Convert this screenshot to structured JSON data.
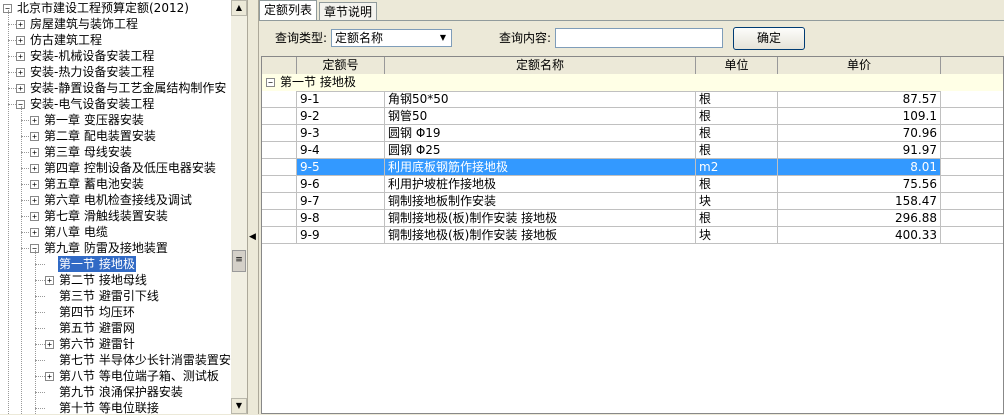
{
  "tree": {
    "root": "北京市建设工程预算定额(2012)",
    "top_items": [
      {
        "label": "房屋建筑与装饰工程",
        "expand": "+"
      },
      {
        "label": "仿古建筑工程",
        "expand": "+"
      },
      {
        "label": "安装-机械设备安装工程",
        "expand": "+"
      },
      {
        "label": "安装-热力设备安装工程",
        "expand": "+"
      },
      {
        "label": "安装-静置设备与工艺金属结构制作安",
        "expand": "+"
      },
      {
        "label": "安装-电气设备安装工程",
        "expand": "−"
      }
    ],
    "chapters": [
      {
        "label": "第一章 变压器安装",
        "expand": "+"
      },
      {
        "label": "第二章 配电装置安装",
        "expand": "+"
      },
      {
        "label": "第三章 母线安装",
        "expand": "+"
      },
      {
        "label": "第四章 控制设备及低压电器安装",
        "expand": "+"
      },
      {
        "label": "第五章 蓄电池安装",
        "expand": "+"
      },
      {
        "label": "第六章 电机检查接线及调试",
        "expand": "+"
      },
      {
        "label": "第七章 滑触线装置安装",
        "expand": "+"
      },
      {
        "label": "第八章 电缆",
        "expand": "+"
      },
      {
        "label": "第九章 防雷及接地装置",
        "expand": "−"
      }
    ],
    "sections": [
      {
        "label": "第一节 接地极",
        "expand": "",
        "selected": true
      },
      {
        "label": "第二节 接地母线",
        "expand": "+"
      },
      {
        "label": "第三节 避雷引下线",
        "expand": ""
      },
      {
        "label": "第四节 均压环",
        "expand": ""
      },
      {
        "label": "第五节 避雷网",
        "expand": ""
      },
      {
        "label": "第六节 避雷针",
        "expand": "+"
      },
      {
        "label": "第七节 半导体少长针消雷装置安",
        "expand": ""
      },
      {
        "label": "第八节 等电位端子箱、测试板",
        "expand": "+"
      },
      {
        "label": "第九节 浪涌保护器安装",
        "expand": ""
      },
      {
        "label": "第十节 等电位联接",
        "expand": ""
      }
    ]
  },
  "tabs": [
    "定额列表",
    "章节说明"
  ],
  "query": {
    "type_label": "查询类型:",
    "type_value": "定额名称",
    "content_label": "查询内容:",
    "content_value": "",
    "ok_label": "确定"
  },
  "grid": {
    "headers": [
      "定额号",
      "定额名称",
      "单位",
      "单价"
    ],
    "group": {
      "expand": "−",
      "label": "第一节 接地极"
    },
    "rows": [
      {
        "code": "9-1",
        "name": "角钢50*50",
        "unit": "根",
        "price": "87.57"
      },
      {
        "code": "9-2",
        "name": "钢管50",
        "unit": "根",
        "price": "109.1"
      },
      {
        "code": "9-3",
        "name": "圆钢 Φ19",
        "unit": "根",
        "price": "70.96"
      },
      {
        "code": "9-4",
        "name": "圆钢 Φ25",
        "unit": "根",
        "price": "91.97"
      },
      {
        "code": "9-5",
        "name": "利用底板钢筋作接地极",
        "unit": "m2",
        "price": "8.01",
        "selected": true
      },
      {
        "code": "9-6",
        "name": "利用护坡桩作接地极",
        "unit": "根",
        "price": "75.56"
      },
      {
        "code": "9-7",
        "name": "铜制接地板制作安装",
        "unit": "块",
        "price": "158.47"
      },
      {
        "code": "9-8",
        "name": "铜制接地极(板)制作安装 接地极",
        "unit": "根",
        "price": "296.88"
      },
      {
        "code": "9-9",
        "name": "铜制接地极(板)制作安装 接地板",
        "unit": "块",
        "price": "400.33"
      }
    ]
  },
  "colors": {
    "selection": "#316ac5",
    "row_selection": "#3399ff",
    "group_bg": "#ffffe6"
  }
}
